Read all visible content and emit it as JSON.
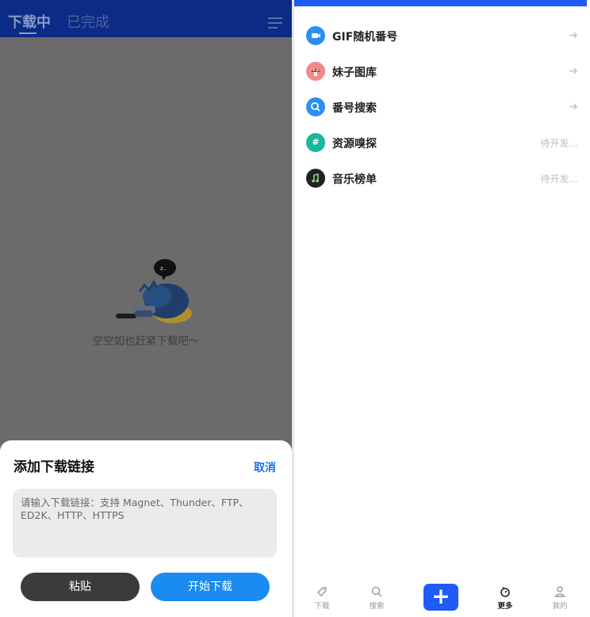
{
  "left": {
    "tabs": [
      {
        "label": "下载中",
        "active": true
      },
      {
        "label": "已完成",
        "active": false
      }
    ],
    "empty_text": "空空如也赶紧下载吧～",
    "sheet": {
      "title": "添加下载链接",
      "cancel_label": "取消",
      "input_placeholder": "请输入下载链接：支持 Magnet、Thunder、FTP、ED2K、HTTP、HTTPS",
      "paste_label": "粘贴",
      "start_label": "开始下载"
    }
  },
  "right": {
    "items": [
      {
        "label": "GIF随机番号",
        "icon": "video-icon",
        "color": "#2b8ff2",
        "status": "arrow"
      },
      {
        "label": "妹子图库",
        "icon": "mushroom-icon",
        "color": "#f08a8a",
        "status": "arrow"
      },
      {
        "label": "番号搜索",
        "icon": "search-icon",
        "color": "#2b8ff2",
        "status": "arrow"
      },
      {
        "label": "资源嗅探",
        "icon": "hash-icon",
        "color": "#19b89a",
        "status": "待开发..."
      },
      {
        "label": "音乐榜单",
        "icon": "music-icon",
        "color": "#222222",
        "status": "待开发..."
      }
    ],
    "arrow_glyph": "➜",
    "nav": {
      "download_label": "下载",
      "search_label": "搜索",
      "add_glyph": "+",
      "more_label": "更多",
      "mine_label": "我的"
    }
  },
  "colors": {
    "header_bg": "#0b2b86",
    "overlay_bg": "#6b6b6b",
    "accent_blue": "#1f5cf5",
    "start_button": "#1a8bf0",
    "paste_button": "#3b3b3b"
  }
}
